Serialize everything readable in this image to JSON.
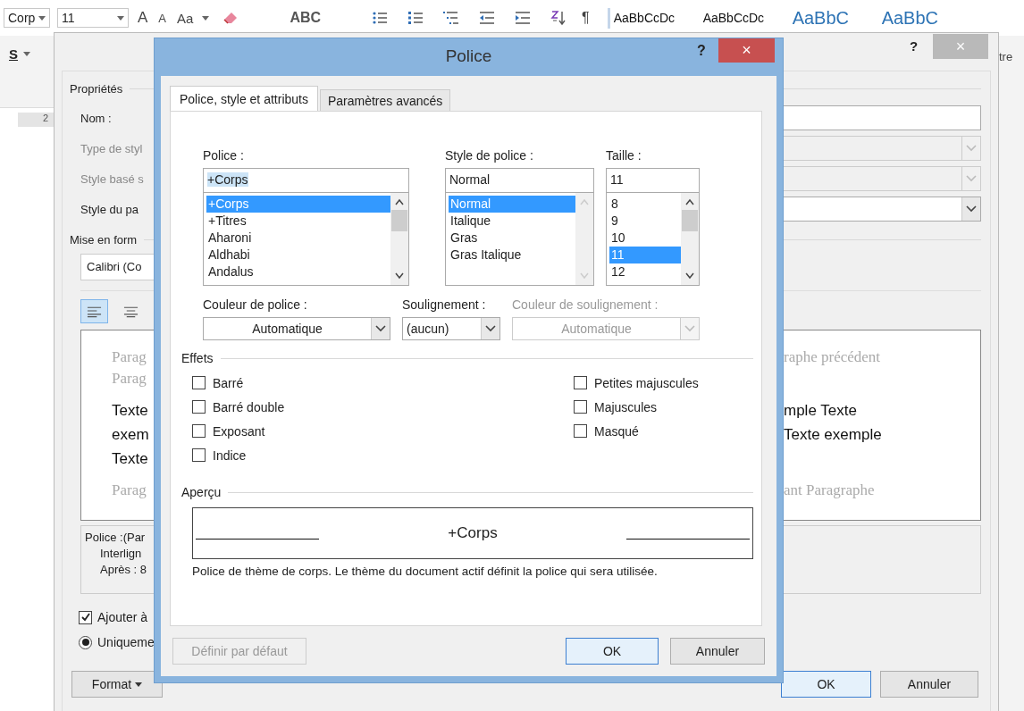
{
  "ribbon": {
    "font_name": "Corp",
    "font_size": "11",
    "grow_font": "A",
    "shrink_font": "A",
    "change_case": "Aa",
    "spelling": "ABC",
    "show_marks": "¶",
    "style_gallery": [
      {
        "sample": "AaBbCcDc",
        "kind": "body"
      },
      {
        "sample": "AaBbCcDc",
        "kind": "body"
      },
      {
        "sample": "AaBbC",
        "kind": "heading"
      },
      {
        "sample": "AaBbC",
        "kind": "heading"
      }
    ],
    "underline": "S",
    "side_label": "tre"
  },
  "ruler_mark": "2",
  "style_dialog": {
    "help": "?",
    "close": "×",
    "properties_heading": "Propriétés",
    "fields": [
      {
        "label": "Nom :",
        "kind": "text",
        "disabled": false
      },
      {
        "label": "Type de styl",
        "kind": "dropdown",
        "disabled": true
      },
      {
        "label": "Style basé s",
        "kind": "dropdown",
        "disabled": true
      },
      {
        "label": "Style du pa",
        "kind": "dropdown",
        "disabled": false
      }
    ],
    "format_heading": "Mise en form",
    "font_field": "Calibri (Co",
    "alignments": [
      {
        "kind": "left",
        "selected": true
      },
      {
        "kind": "center",
        "selected": false
      }
    ],
    "preview": [
      {
        "kind": "previous",
        "left": "Parag",
        "right": "raphe précédent"
      },
      {
        "kind": "previous",
        "left": "Parag"
      },
      {
        "kind": "sample",
        "left": "Texte",
        "right": "mple Texte"
      },
      {
        "kind": "sample",
        "left": "exem",
        "right": "Texte exemple"
      },
      {
        "kind": "sample",
        "left": "Texte"
      },
      {
        "kind": "next",
        "left": "Parag",
        "right": "ant Paragraphe"
      }
    ],
    "description": [
      "Police :(Par",
      "Interlign",
      "Après : 8"
    ],
    "add_to_gallery": {
      "label": "Ajouter à",
      "checked": true
    },
    "scope": {
      "label": "Uniqueme",
      "selected": true
    },
    "format_button": "Format",
    "ok": "OK",
    "cancel": "Annuler"
  },
  "font_dialog": {
    "title": "Police",
    "help": "?",
    "close": "×",
    "tabs": [
      {
        "label": "Police, style et attributs",
        "selected": true
      },
      {
        "label": "Paramètres avancés",
        "selected": false
      }
    ],
    "lists": [
      {
        "label": "Police :",
        "value": "+Corps",
        "value_selected": true,
        "scroll_disabled": false,
        "items": [
          {
            "label": "+Corps",
            "selected": true
          },
          {
            "label": "+Titres",
            "selected": false
          },
          {
            "label": "Aharoni",
            "selected": false
          },
          {
            "label": "Aldhabi",
            "selected": false
          },
          {
            "label": "Andalus",
            "selected": false
          }
        ]
      },
      {
        "label": "Style de police :",
        "value": "Normal",
        "value_selected": false,
        "scroll_disabled": true,
        "items": [
          {
            "label": "Normal",
            "selected": true
          },
          {
            "label": "Italique",
            "selected": false
          },
          {
            "label": "Gras",
            "selected": false
          },
          {
            "label": "Gras Italique",
            "selected": false
          }
        ]
      },
      {
        "label": "Taille :",
        "value": "11",
        "value_selected": false,
        "scroll_disabled": false,
        "items": [
          {
            "label": "8",
            "selected": false
          },
          {
            "label": "9",
            "selected": false
          },
          {
            "label": "10",
            "selected": false
          },
          {
            "label": "11",
            "selected": true
          },
          {
            "label": "12",
            "selected": false
          }
        ]
      }
    ],
    "dropdowns": [
      {
        "label": "Couleur de police :",
        "value": "Automatique",
        "disabled": false
      },
      {
        "label": "Soulignement :",
        "value": "(aucun)",
        "disabled": false
      },
      {
        "label": "Couleur de soulignement :",
        "value": "Automatique",
        "disabled": true
      }
    ],
    "effects_heading": "Effets",
    "effect_columns": [
      [
        {
          "label": "Barré",
          "checked": false
        },
        {
          "label": "Barré double",
          "checked": false
        },
        {
          "label": "Exposant",
          "checked": false
        },
        {
          "label": "Indice",
          "checked": false
        }
      ],
      [
        {
          "label": "Petites majuscules",
          "checked": false
        },
        {
          "label": "Majuscules",
          "checked": false
        },
        {
          "label": "Masqué",
          "checked": false
        }
      ]
    ],
    "preview_heading": "Aperçu",
    "preview_text": "+Corps",
    "preview_note": "Police de thème de corps. Le thème du document actif définit la police qui sera utilisée.",
    "buttons": [
      {
        "label": "Définir par défaut",
        "kind": "secondary",
        "disabled": true
      },
      {
        "label": "OK",
        "kind": "default",
        "disabled": false
      },
      {
        "label": "Annuler",
        "kind": "secondary",
        "disabled": false
      }
    ]
  }
}
